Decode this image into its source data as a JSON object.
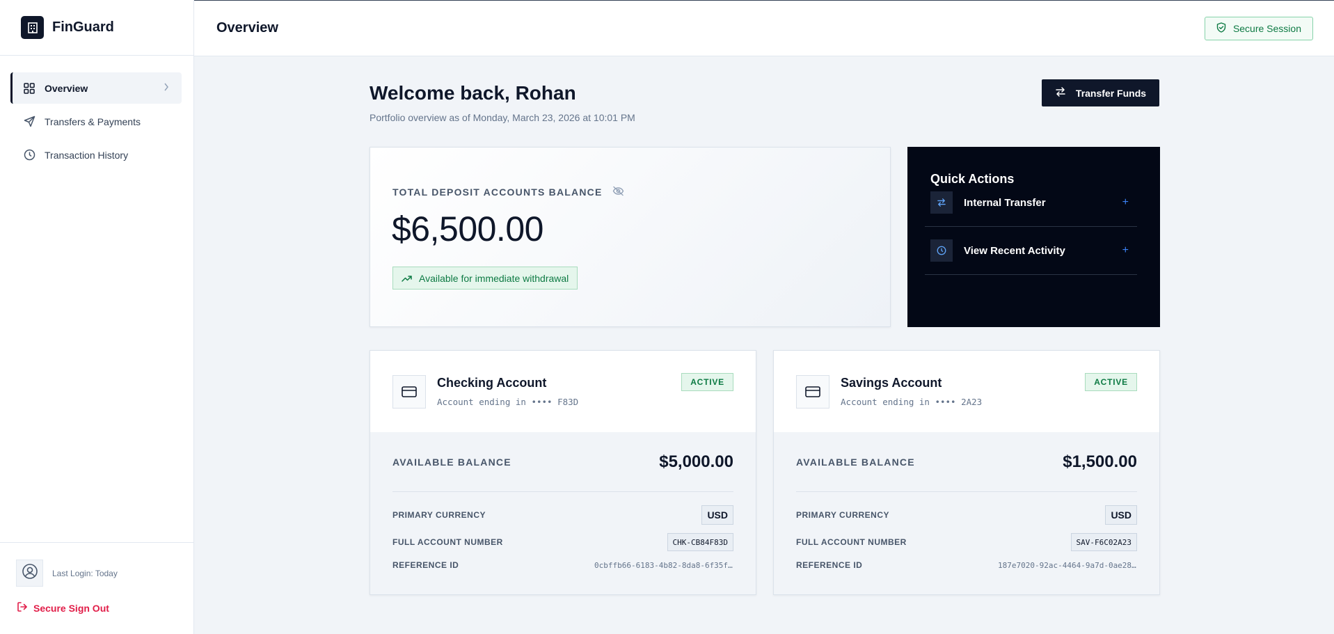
{
  "brand": {
    "name": "FinGuard"
  },
  "sidebar": {
    "items": [
      {
        "label": "Overview"
      },
      {
        "label": "Transfers & Payments"
      },
      {
        "label": "Transaction History"
      }
    ],
    "last_login": "Last Login: Today",
    "signout_label": "Secure Sign Out"
  },
  "header": {
    "title": "Overview",
    "secure_label": "Secure Session"
  },
  "main": {
    "welcome": "Welcome back, Rohan",
    "subtitle": "Portfolio overview as of Monday, March 23, 2026 at 10:01 PM",
    "transfer_label": "Transfer Funds",
    "balance": {
      "label": "TOTAL DEPOSIT ACCOUNTS BALANCE",
      "amount": "$6,500.00",
      "badge": "Available for immediate withdrawal"
    },
    "quick_actions": {
      "title": "Quick Actions",
      "items": [
        {
          "label": "Internal Transfer",
          "plus": "+"
        },
        {
          "label": "View Recent Activity",
          "plus": "+"
        }
      ]
    },
    "accounts": [
      {
        "name": "Checking Account",
        "ending": "Account ending in •••• F83D",
        "status": "ACTIVE",
        "available_label": "AVAILABLE BALANCE",
        "available_value": "$5,000.00",
        "currency_label": "PRIMARY CURRENCY",
        "currency": "USD",
        "account_no_label": "FULL ACCOUNT NUMBER",
        "account_no": "CHK-CB84F83D",
        "reference_label": "REFERENCE ID",
        "reference": "0cbffb66-6183-4b82-8da8-6f35f..."
      },
      {
        "name": "Savings Account",
        "ending": "Account ending in •••• 2A23",
        "status": "ACTIVE",
        "available_label": "AVAILABLE BALANCE",
        "available_value": "$1,500.00",
        "currency_label": "PRIMARY CURRENCY",
        "currency": "USD",
        "account_no_label": "FULL ACCOUNT NUMBER",
        "account_no": "SAV-F6C02A23",
        "reference_label": "REFERENCE ID",
        "reference": "187e7020-92ac-4464-9a7d-0ae28..."
      }
    ]
  },
  "colors": {
    "primary": "#0f172a",
    "success": "#0d7a43",
    "danger": "#e11d48",
    "accent": "#3b82f6"
  },
  "icons": [
    "building-icon",
    "grid-icon",
    "chevron-right-icon",
    "send-icon",
    "clock-icon",
    "user-circle-icon",
    "logout-icon",
    "shield-check-icon",
    "arrows-swap-icon",
    "eye-off-icon",
    "trend-up-icon",
    "credit-card-icon",
    "plus-icon"
  ]
}
